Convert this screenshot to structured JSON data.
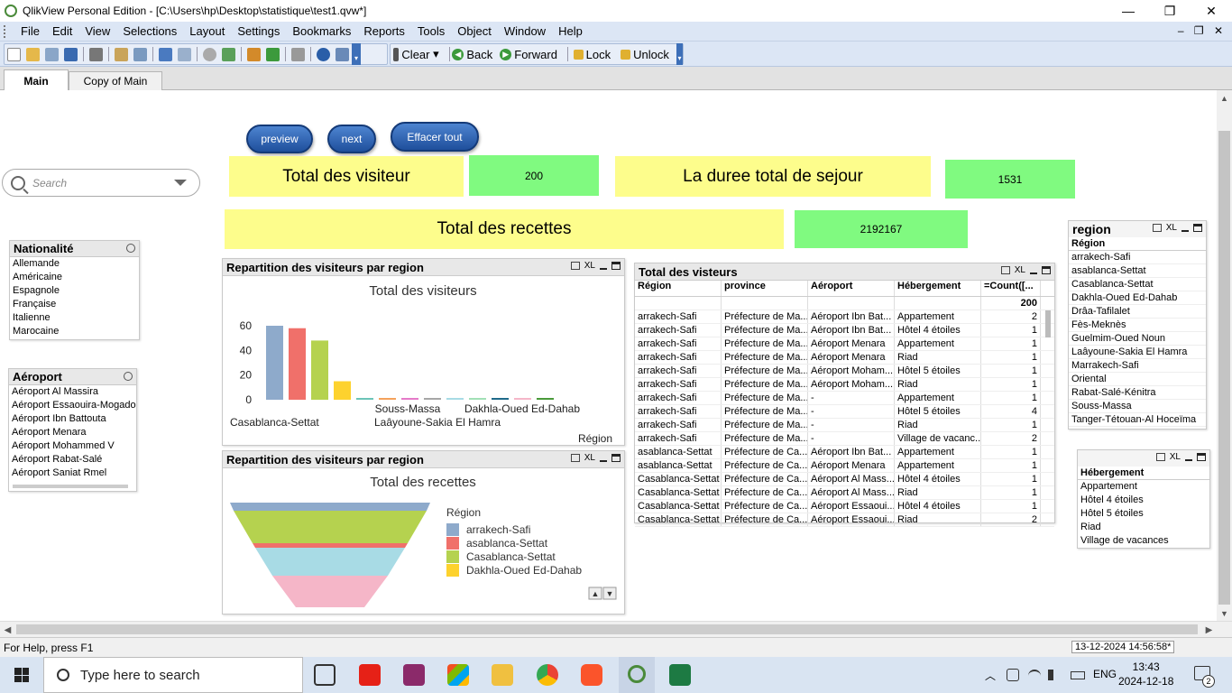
{
  "window": {
    "title": "QlikView Personal Edition - [C:\\Users\\hp\\Desktop\\statistique\\test1.qvw*]",
    "controls": [
      "—",
      "❐",
      "✕"
    ]
  },
  "menubar": {
    "items": [
      "File",
      "Edit",
      "View",
      "Selections",
      "Layout",
      "Settings",
      "Bookmarks",
      "Reports",
      "Tools",
      "Object",
      "Window",
      "Help"
    ],
    "mdi_controls": "– ❐ ✕"
  },
  "toolbar": {
    "clear_label": "Clear",
    "back_label": "Back",
    "forward_label": "Forward",
    "lock_label": "Lock",
    "unlock_label": "Unlock"
  },
  "tabs": [
    {
      "label": "Main",
      "active": true
    },
    {
      "label": "Copy of Main",
      "active": false
    }
  ],
  "buttons": {
    "preview": "preview",
    "next": "next",
    "clear_all": "Effacer tout"
  },
  "search": {
    "placeholder": "Search"
  },
  "kpis": {
    "visitors_label": "Total des visiteur",
    "visitors_value": "200",
    "duration_label": "La duree total de sejour",
    "duration_value": "1531",
    "revenue_label": "Total des recettes",
    "revenue_value": "2192167"
  },
  "listboxes": {
    "nationalite": {
      "title": "Nationalité",
      "items": [
        "Allemande",
        "Américaine",
        "Espagnole",
        "Française",
        "Italienne",
        "Marocaine"
      ]
    },
    "aeroport": {
      "title": "Aéroport",
      "items": [
        "Aéroport Al Massira",
        "Aéroport Essaouira-Mogador",
        "Aéroport Ibn Battouta",
        "Aéroport Menara",
        "Aéroport Mohammed V",
        "Aéroport Rabat-Salé",
        "Aéroport Saniat Rmel"
      ]
    },
    "region": {
      "title": "region",
      "header": "Région",
      "items": [
        "arrakech-Safi",
        "asablanca-Settat",
        "Casablanca-Settat",
        "Dakhla-Oued Ed-Dahab",
        "Drâa-Tafilalet",
        "Fès-Meknès",
        "Guelmim-Oued Noun",
        "Laâyoune-Sakia El Hamra",
        "Marrakech-Safi",
        "Oriental",
        "Rabat-Salé-Kénitra",
        "Souss-Massa",
        "Tanger-Tétouan-Al Hoceïma"
      ]
    },
    "hebergement": {
      "header": "Hébergement",
      "items": [
        "Appartement",
        "Hôtel 4 étoiles",
        "Hôtel 5 étoiles",
        "Riad",
        "Village de vacances"
      ]
    }
  },
  "chart_visitors": {
    "caption": "Repartition des visiteurs par region",
    "title": "Total des visiteurs",
    "xlabel": "Région",
    "cat_labels_row1": [
      "Souss-Massa",
      "Dakhla-Oued Ed-Dahab"
    ],
    "cat_labels_row2": [
      "Casablanca-Settat",
      "Laâyoune-Sakia El Hamra"
    ],
    "yticks": [
      "60",
      "40",
      "20",
      "0"
    ]
  },
  "chart_recettes": {
    "caption": "Repartition des visiteurs par region",
    "title": "Total des recettes",
    "legend_title": "Région",
    "legend": [
      {
        "label": "arrakech-Safi",
        "color": "#8eaacb"
      },
      {
        "label": "asablanca-Settat",
        "color": "#f0706a"
      },
      {
        "label": "Casablanca-Settat",
        "color": "#b5d24f"
      },
      {
        "label": "Dakhla-Oued Ed-Dahab",
        "color": "#fdd22e"
      }
    ]
  },
  "chart_data": [
    {
      "type": "bar",
      "title": "Total des visiteurs",
      "xlabel": "Région",
      "ylim": [
        0,
        70
      ],
      "categories": [
        "arrakech-Safi",
        "asablanca-Settat",
        "Casablanca-Settat",
        "Dakhla-Oued Ed-Dahab",
        "Drâa-Tafilalet",
        "Fès-Meknès",
        "Guelmim-Oued Noun",
        "Laâyoune-Sakia El Hamra",
        "Marrakech-Safi",
        "Oriental",
        "Rabat-Salé-Kénitra",
        "Souss-Massa",
        "Tanger-Tétouan-Al Hoceïma"
      ],
      "values": [
        60,
        58,
        48,
        15,
        1,
        1,
        1,
        1,
        1,
        1,
        1,
        1,
        1
      ],
      "colors": [
        "#8eaacb",
        "#f0706a",
        "#b5d24f",
        "#fdd22e",
        "#6cc4b8",
        "#f4a25c",
        "#e57ac8",
        "#a7a7a7",
        "#a8dbe5",
        "#a2e0b6",
        "#1f6a8a",
        "#f5b6c8",
        "#4a9a3a"
      ]
    },
    {
      "type": "funnel",
      "title": "Total des recettes",
      "segments": [
        {
          "label": "arrakech-Safi",
          "color": "#8eaacb"
        },
        {
          "label": "asablanca-Settat",
          "color": "#f0706a"
        },
        {
          "label": "Casablanca-Settat",
          "color": "#b5d24f"
        },
        {
          "label": "Dakhla-Oued Ed-Dahab",
          "color": "#fdd22e"
        }
      ]
    }
  ],
  "table": {
    "caption": "Total des visteurs",
    "headers": [
      "Région",
      "province",
      "Aéroport",
      "Hébergement",
      "=Count([..."
    ],
    "total": "200",
    "rows": [
      [
        "arrakech-Safi",
        "Préfecture de Ma...",
        "Aéroport Ibn Bat...",
        "Appartement",
        "2"
      ],
      [
        "arrakech-Safi",
        "Préfecture de Ma...",
        "Aéroport Ibn Bat...",
        "Hôtel 4 étoiles",
        "1"
      ],
      [
        "arrakech-Safi",
        "Préfecture de Ma...",
        "Aéroport Menara",
        "Appartement",
        "1"
      ],
      [
        "arrakech-Safi",
        "Préfecture de Ma...",
        "Aéroport Menara",
        "Riad",
        "1"
      ],
      [
        "arrakech-Safi",
        "Préfecture de Ma...",
        "Aéroport Moham...",
        "Hôtel 5 étoiles",
        "1"
      ],
      [
        "arrakech-Safi",
        "Préfecture de Ma...",
        "Aéroport Moham...",
        "Riad",
        "1"
      ],
      [
        "arrakech-Safi",
        "Préfecture de Ma...",
        "-",
        "Appartement",
        "1"
      ],
      [
        "arrakech-Safi",
        "Préfecture de Ma...",
        "-",
        "Hôtel 5 étoiles",
        "4"
      ],
      [
        "arrakech-Safi",
        "Préfecture de Ma...",
        "-",
        "Riad",
        "1"
      ],
      [
        "arrakech-Safi",
        "Préfecture de Ma...",
        "-",
        "Village de vacanc...",
        "2"
      ],
      [
        "asablanca-Settat",
        "Préfecture de Ca...",
        "Aéroport Ibn Bat...",
        "Appartement",
        "1"
      ],
      [
        "asablanca-Settat",
        "Préfecture de Ca...",
        "Aéroport Menara",
        "Appartement",
        "1"
      ],
      [
        "Casablanca-Settat",
        "Préfecture de Ca...",
        "Aéroport Al Mass...",
        "Hôtel 4 étoiles",
        "1"
      ],
      [
        "Casablanca-Settat",
        "Préfecture de Ca...",
        "Aéroport Al Mass...",
        "Riad",
        "1"
      ],
      [
        "Casablanca-Settat",
        "Préfecture de Ca...",
        "Aéroport Essaoui...",
        "Hôtel 4 étoiles",
        "1"
      ],
      [
        "Casablanca-Settat",
        "Préfecture de Ca...",
        "Aéroport Essaoui...",
        "Riad",
        "2"
      ]
    ]
  },
  "statusbar": {
    "help": "For Help, press F1",
    "timestamp": "13-12-2024 14:56:58*"
  },
  "taskbar": {
    "search_placeholder": "Type here to search",
    "lang": "ENG",
    "time": "13:43",
    "date": "2024-12-18",
    "notifications": "2"
  },
  "caption_icon_text": "XL"
}
